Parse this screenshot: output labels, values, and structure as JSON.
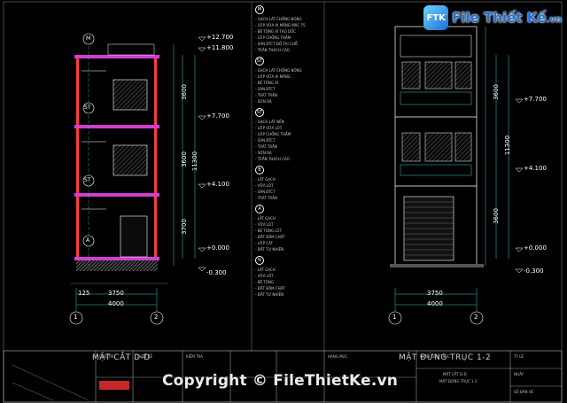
{
  "brand": {
    "name": "File Thiết Kế",
    "domain": ".vn",
    "logo_letters": "FTK"
  },
  "watermark": "Copyright © FileThietKe.vn",
  "section": {
    "title": "MẶT CẮT D-D",
    "total_width": "4000",
    "span": "3750",
    "offset": "125",
    "axis_left": "1",
    "axis_right": "2",
    "floor_labels": [
      "M",
      "ST",
      "ST",
      "A"
    ],
    "level_labels": [
      "+12.700",
      "+11.800",
      "+7.700",
      "+4.100",
      "+0.000",
      "-0.300"
    ],
    "height_dims": [
      "3600",
      "3600",
      "3700",
      "11300"
    ]
  },
  "elevation": {
    "title": "MẶT ĐỨNG TRỤC 1-2",
    "total_width": "4000",
    "span": "3750",
    "axis_left": "1",
    "axis_right": "2",
    "level_labels": [
      "+7.700",
      "+4.100",
      "+0.000",
      "-0.300"
    ],
    "height_dims": [
      "3600",
      "3600",
      "11300"
    ]
  },
  "notes": [
    {
      "id": "M",
      "lines": [
        "- GẠCH LÁT CHỐNG NÓNG",
        "- LỚP VỮA XI MĂNG MÁC 75",
        "- BÊ TÔNG XỈ TẠO DỐC",
        "- LỚP CHỐNG THẤM",
        "- SÀN BTCT ĐỔ TẠI CHỖ",
        "- TRẦN THẠCH CAO"
      ]
    },
    {
      "id": "ST",
      "lines": [
        "- GẠCH LÁT CHỐNG NÓNG",
        "- LỚP VỮA XI MĂNG",
        "- BÊ TÔNG XỈ",
        "- SÀN BTCT",
        "- TRÁT TRẦN",
        "- SƠN BẢ"
      ]
    },
    {
      "id": "ST",
      "lines": [
        "- GẠCH LÁT NỀN",
        "- LỚP VỮA LÓT",
        "- LỚP CHỐNG THẤM",
        "- SÀN BTCT",
        "- TRÁT TRẦN",
        "- SƠN BẢ",
        "- TRẦN THẠCH CAO"
      ]
    },
    {
      "id": "B",
      "lines": [
        "- LÁT GẠCH",
        "- VỮA LÓT",
        "- SÀN BTCT",
        "- TRÁT TRẦN"
      ]
    },
    {
      "id": "A",
      "lines": [
        "- LÁT GẠCH",
        "- VỮA LÓT",
        "- BÊ TÔNG LÓT",
        "- ĐẤT ĐẦM CHẶT",
        "- LỚP CÁT",
        "- ĐẤT TỰ NHIÊN"
      ]
    },
    {
      "id": "N",
      "lines": [
        "- LÁT GẠCH",
        "- VỮA LÓT",
        "- BÊ TÔNG",
        "- ĐẤT ĐẦM CHẶT",
        "- ĐẤT TỰ NHIÊN"
      ]
    }
  ],
  "title_block": {
    "project_label": "PHẦN KIẾN TRÚC",
    "drawing_names": [
      "MẶT CẮT D-D",
      "MẶT ĐỨNG TRỤC 1-2"
    ],
    "cells": [
      "CHỦ TRÌ",
      "THIẾT KẾ",
      "KIỂM TRA",
      "HẠNG MỤC",
      "TỶ LỆ",
      "NGÀY",
      "SỐ BẢN VẼ"
    ]
  },
  "colors": {
    "background": "#000000",
    "wall": "#ff3b3b",
    "slab": "#d23dd2",
    "line": "#ffffff",
    "dim": "#3ec7c7"
  }
}
